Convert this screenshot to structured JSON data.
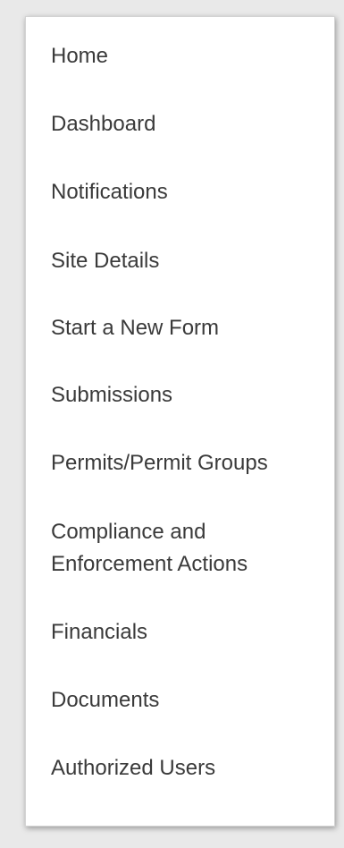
{
  "nav": {
    "items": [
      {
        "label": "Home"
      },
      {
        "label": "Dashboard"
      },
      {
        "label": "Notifications"
      },
      {
        "label": "Site Details"
      },
      {
        "label": "Start a New Form"
      },
      {
        "label": "Submissions"
      },
      {
        "label": "Permits/Permit Groups"
      },
      {
        "label": "Compliance and Enforcement Actions"
      },
      {
        "label": "Financials"
      },
      {
        "label": "Documents"
      },
      {
        "label": "Authorized Users"
      }
    ]
  }
}
